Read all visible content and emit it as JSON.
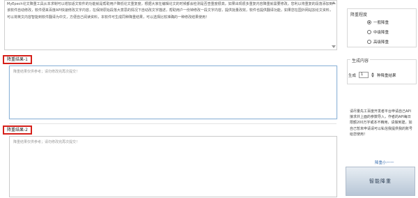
{
  "input": {
    "text": "MyEpech论文降重工具从本求制可以增加适文软件的功能就是帮助用户降低论文重复度，根据大家在编辑论文的时候都会检测是否查重度很高，如果出现很多重复内容降重就需要修改，您利以将重复的段落添加到该软件自动修改，软件便来百度API快速修改文字内容，在保持原始段落大意思的情况下自动改文字描述，帮助用户一份钟修改一段文字内容，提供批量改效，软件也提供翻译功能，如果您在国外网站加论文资料，可以将英文内容智能到软件翻译为中文，方便自己阅读资料，本软件可生成同种降重结果，可以选择比较准确的一种修改结果使用！"
  },
  "results": [
    {
      "label": "降重结果-1",
      "placeholder": "降重结果仅供参考；请勿修改完再次提交！"
    },
    {
      "label": "降重结果-2",
      "placeholder": "降重结果仅供参考；请勿修改完再次提交！"
    }
  ],
  "sidebar": {
    "degree_title": "降重程度",
    "options": [
      {
        "label": "一般降重",
        "checked": true
      },
      {
        "label": "中级降重",
        "checked": false
      },
      {
        "label": "高级降重",
        "checked": false
      }
    ],
    "count_title": "生成内容",
    "count_prefix": "生成",
    "count_value": "1",
    "count_suffix": "种降重结果",
    "description": "请尽量先工百度开发者平台申请自己API接求并上面的参数导入，作者的API每日限额200万字或本不精用，请做到建，如自己暂未申请请可以私信我提供我的账号给您使用！",
    "link_text": "降重小一一",
    "submit_label": "智能降重"
  }
}
